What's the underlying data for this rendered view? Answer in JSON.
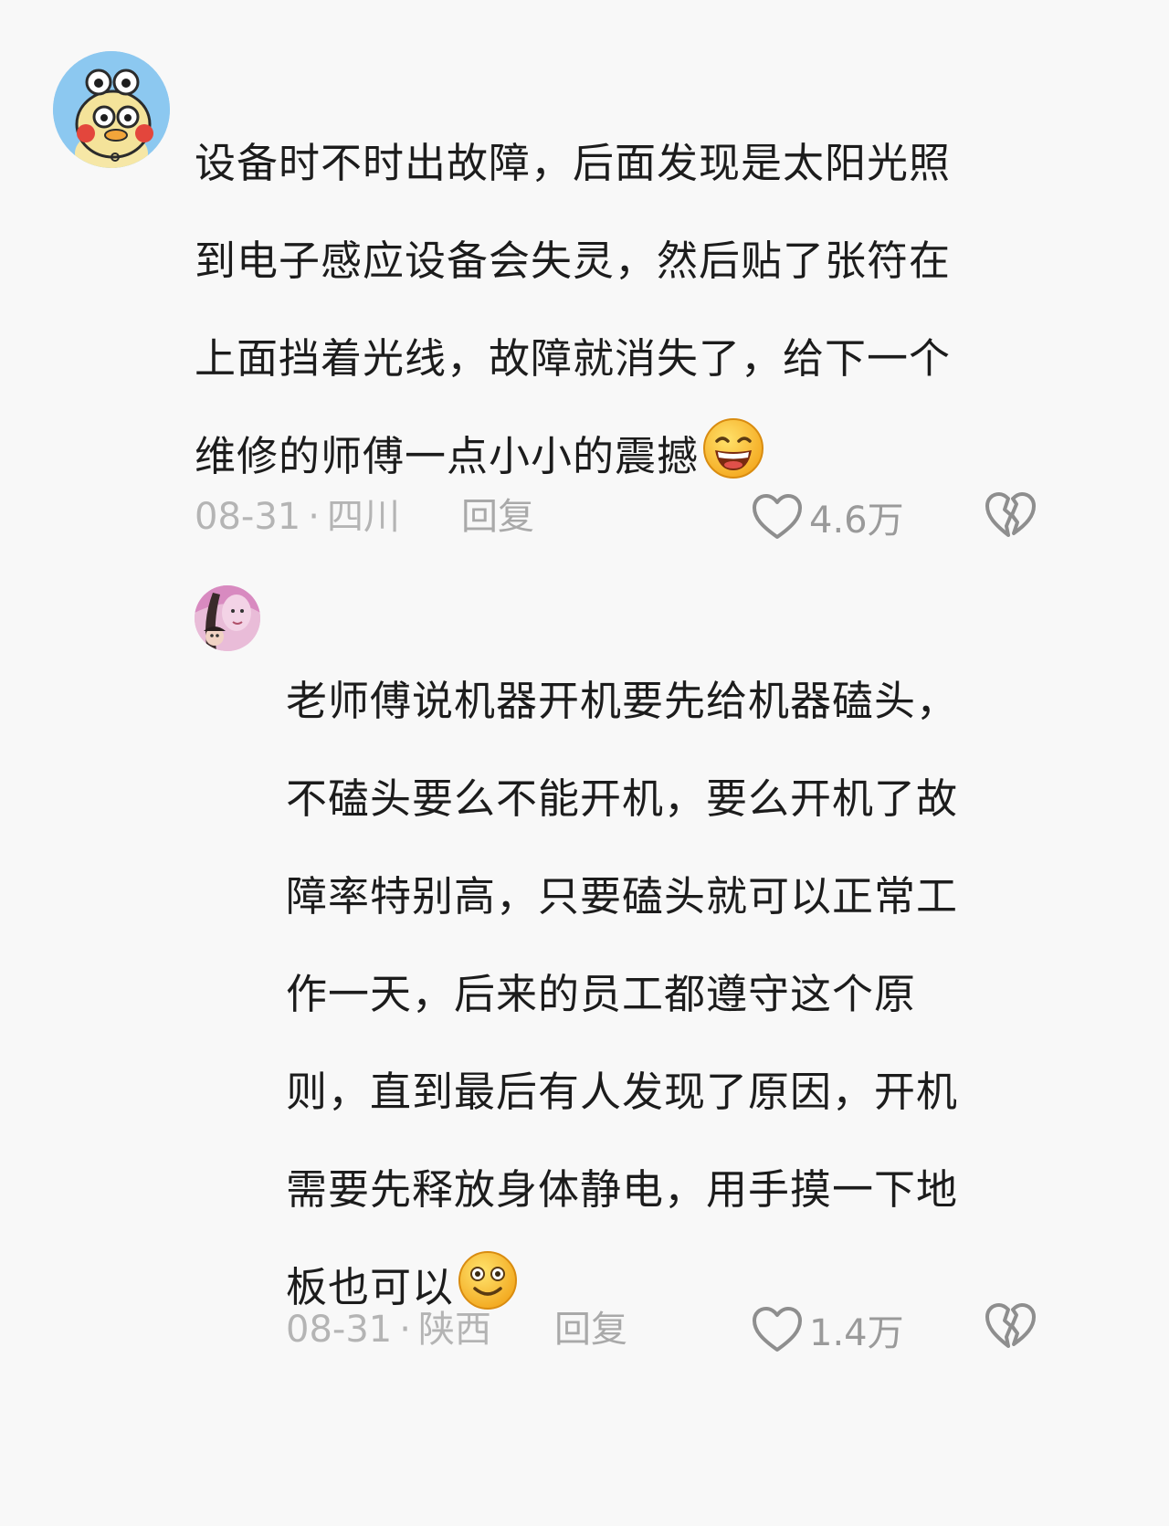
{
  "comments": [
    {
      "text_lines": [
        "设备时不时出故障，后面发现是太阳光照",
        "到电子感应设备会失灵，然后贴了张符在",
        "上面挡着光线，故障就消失了，给下一个",
        "维修的师傅一点小小的震撼"
      ],
      "emoji": "grin-emoji",
      "date": "08-31",
      "location": "四川",
      "reply_label": "回复",
      "like_count": "4.6万"
    },
    {
      "text_lines": [
        "老师傅说机器开机要先给机器磕头，",
        "不磕头要么不能开机，要么开机了故",
        "障率特别高，只要磕头就可以正常工",
        "作一天，后来的员工都遵守这个原",
        "则，直到最后有人发现了原因，开机",
        "需要先释放身体静电，用手摸一下地",
        "板也可以"
      ],
      "emoji": "smile-emoji",
      "date": "08-31",
      "location": "陕西",
      "reply_label": "回复",
      "like_count": "1.4万"
    }
  ],
  "separator": "·",
  "colors": {
    "background": "#f8f8f8",
    "text": "#1c1c1c",
    "meta": "#b4b4b4"
  }
}
